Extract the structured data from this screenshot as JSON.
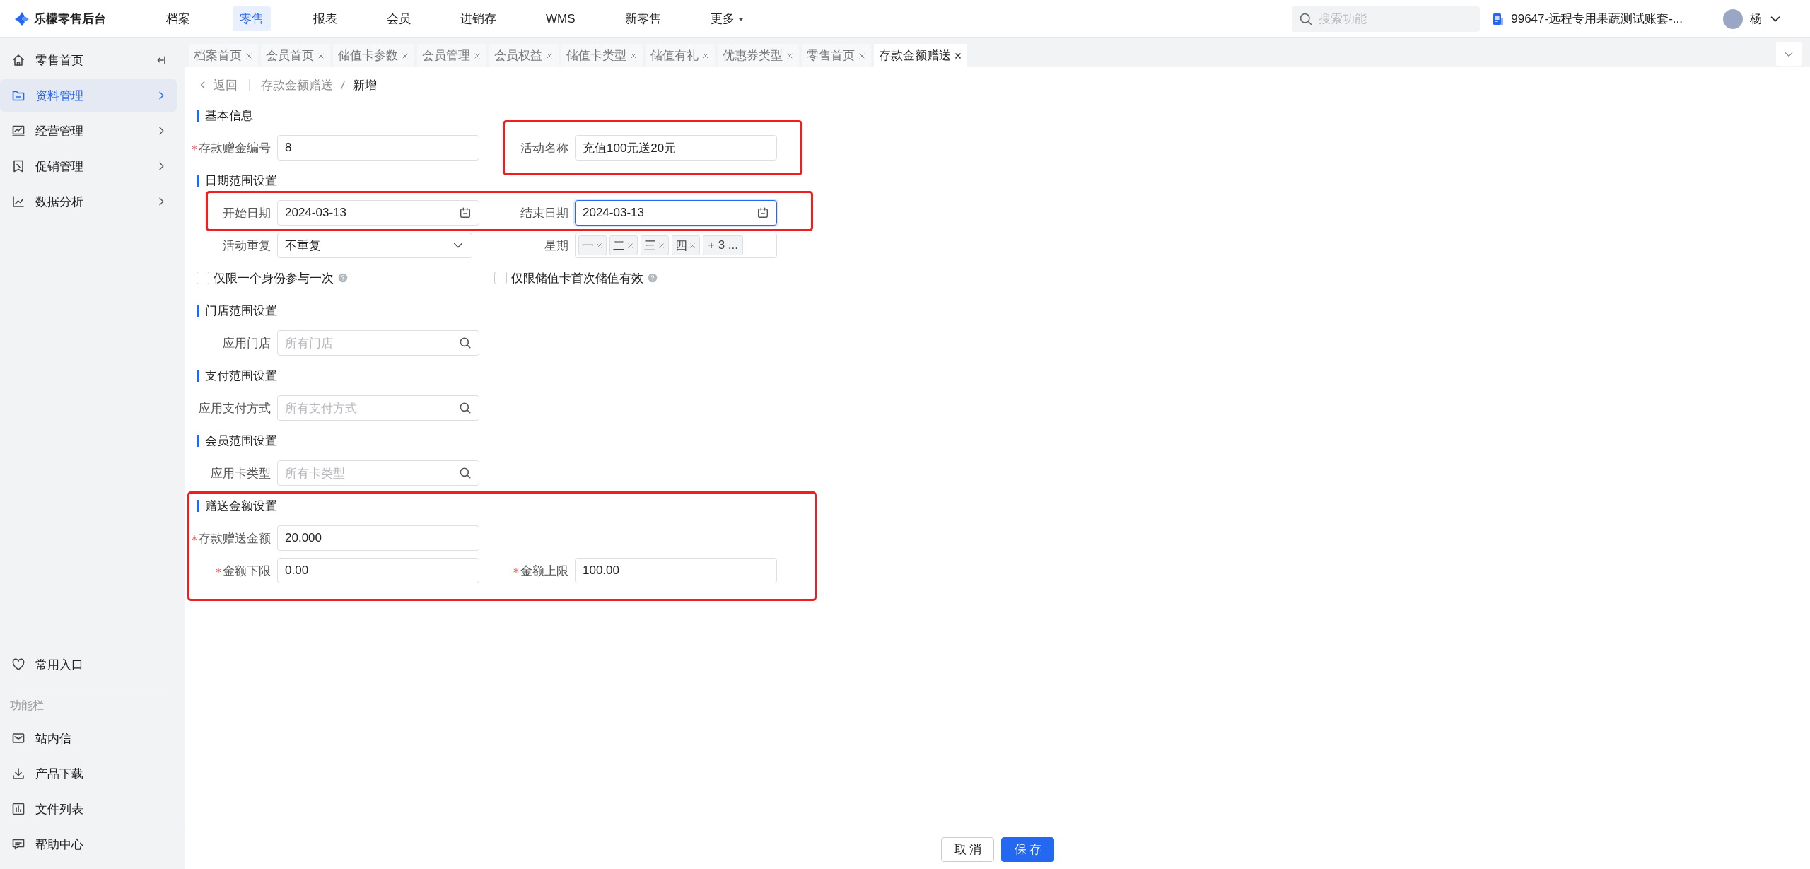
{
  "app": {
    "title": "乐檬零售后台"
  },
  "top_nav": [
    {
      "label": "档案",
      "selected": false,
      "kind": "link"
    },
    {
      "label": "零售",
      "selected": true,
      "kind": "link"
    },
    {
      "label": "报表",
      "selected": false,
      "kind": "link"
    },
    {
      "label": "会员",
      "selected": false,
      "kind": "link"
    },
    {
      "label": "进销存",
      "selected": false,
      "kind": "link"
    },
    {
      "label": "WMS",
      "selected": false,
      "kind": "link"
    },
    {
      "label": "新零售",
      "selected": false,
      "kind": "link"
    },
    {
      "label": "更多",
      "selected": false,
      "kind": "menu"
    }
  ],
  "search": {
    "placeholder": "搜索功能"
  },
  "account": {
    "label": "99647-远程专用果蔬测试账套-..."
  },
  "user": {
    "name": "杨"
  },
  "sidebar": {
    "items": [
      {
        "label": "零售首页",
        "selected": false
      },
      {
        "label": "资料管理",
        "selected": true
      },
      {
        "label": "经营管理",
        "selected": false
      },
      {
        "label": "促销管理",
        "selected": false
      },
      {
        "label": "数据分析",
        "selected": false
      }
    ],
    "favorites": {
      "label": "常用入口"
    },
    "tools_title": "功能栏",
    "tools": [
      {
        "label": "站内信"
      },
      {
        "label": "产品下载"
      },
      {
        "label": "文件列表"
      },
      {
        "label": "帮助中心"
      }
    ]
  },
  "tabs": [
    {
      "label": "档案首页",
      "selected": false
    },
    {
      "label": "会员首页",
      "selected": false
    },
    {
      "label": "储值卡参数",
      "selected": false
    },
    {
      "label": "会员管理",
      "selected": false
    },
    {
      "label": "会员权益",
      "selected": false
    },
    {
      "label": "储值卡类型",
      "selected": false
    },
    {
      "label": "储值有礼",
      "selected": false
    },
    {
      "label": "优惠券类型",
      "selected": false
    },
    {
      "label": "零售首页",
      "selected": false
    },
    {
      "label": "存款金额赠送",
      "selected": true
    }
  ],
  "breadcrumb": {
    "back": "返回",
    "items": [
      "存款金额赠送",
      "新增"
    ]
  },
  "sections": [
    {
      "title": "基本信息",
      "highlighted": false,
      "rows": [
        {
          "highlighted": false,
          "fields": [
            {
              "kind": "input",
              "label": "存款赠金编号",
              "required": true,
              "value": "8",
              "focused": false,
              "highlighted": false
            },
            {
              "kind": "input",
              "label": "活动名称",
              "required": false,
              "value": "充值100元送20元",
              "focused": false,
              "highlighted": true
            }
          ]
        }
      ]
    },
    {
      "title": "日期范围设置",
      "highlighted": false,
      "rows": [
        {
          "highlighted": true,
          "fields": [
            {
              "kind": "date",
              "label": "开始日期",
              "required": false,
              "value": "2024-03-13",
              "focused": false,
              "highlighted": false
            },
            {
              "kind": "date",
              "label": "结束日期",
              "required": false,
              "value": "2024-03-13",
              "focused": true,
              "highlighted": false
            }
          ]
        },
        {
          "highlighted": false,
          "fields": [
            {
              "kind": "select",
              "label": "活动重复",
              "required": false,
              "value": "不重复",
              "focused": false,
              "highlighted": false
            },
            {
              "kind": "tags",
              "label": "星期",
              "required": false,
              "tags": [
                "一",
                "二",
                "三",
                "四"
              ],
              "more": "+ 3 ...",
              "focused": false,
              "highlighted": false
            }
          ]
        },
        {
          "highlighted": false,
          "fields": [
            {
              "kind": "checkbox",
              "label": "仅限一个身份参与一次",
              "checked": false,
              "highlighted": false
            },
            {
              "kind": "checkbox",
              "label": "仅限储值卡首次储值有效",
              "checked": false,
              "highlighted": false
            }
          ]
        }
      ]
    },
    {
      "title": "门店范围设置",
      "highlighted": false,
      "rows": [
        {
          "highlighted": false,
          "fields": [
            {
              "kind": "search",
              "label": "应用门店",
              "required": false,
              "placeholder": "所有门店",
              "focused": false,
              "highlighted": false
            }
          ]
        }
      ]
    },
    {
      "title": "支付范围设置",
      "highlighted": false,
      "rows": [
        {
          "highlighted": false,
          "fields": [
            {
              "kind": "search",
              "label": "应用支付方式",
              "required": false,
              "placeholder": "所有支付方式",
              "focused": false,
              "highlighted": false
            }
          ]
        }
      ]
    },
    {
      "title": "会员范围设置",
      "highlighted": false,
      "rows": [
        {
          "highlighted": false,
          "fields": [
            {
              "kind": "search",
              "label": "应用卡类型",
              "required": false,
              "placeholder": "所有卡类型",
              "focused": false,
              "highlighted": false
            }
          ]
        }
      ]
    },
    {
      "title": "赠送金额设置",
      "highlighted": true,
      "rows": [
        {
          "highlighted": false,
          "fields": [
            {
              "kind": "input",
              "label": "存款赠送金额",
              "required": true,
              "value": "20.000",
              "focused": false,
              "highlighted": false
            }
          ]
        },
        {
          "highlighted": false,
          "fields": [
            {
              "kind": "input",
              "label": "金额下限",
              "required": true,
              "value": "0.00",
              "focused": false,
              "highlighted": false
            },
            {
              "kind": "input",
              "label": "金额上限",
              "required": true,
              "value": "100.00",
              "focused": false,
              "highlighted": false
            }
          ]
        }
      ]
    }
  ],
  "actions": [
    {
      "label": "取消",
      "kind": "default"
    },
    {
      "label": "保存",
      "kind": "primary"
    }
  ]
}
